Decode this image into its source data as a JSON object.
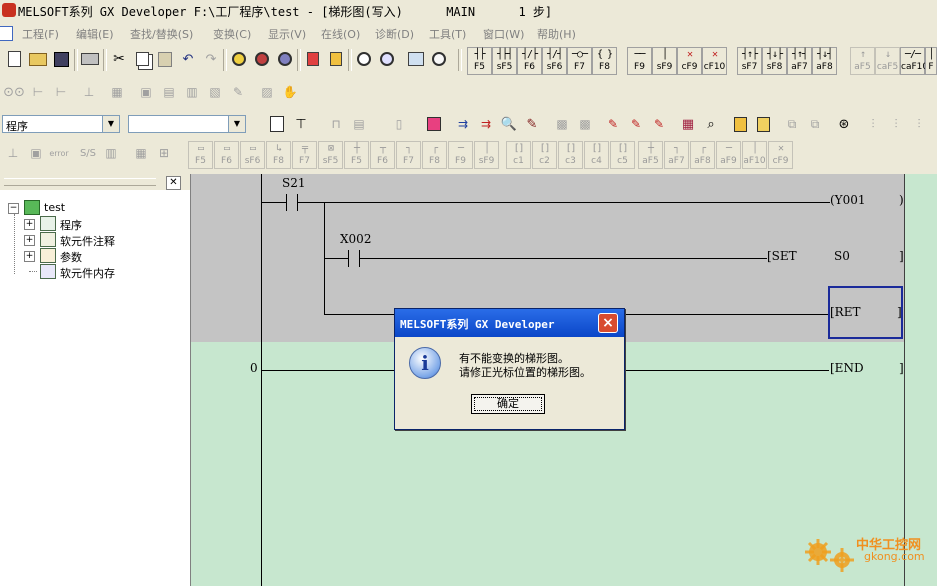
{
  "window": {
    "title": "MELSOFT系列 GX Developer F:\\工厂程序\\test - [梯形图(写入)      MAIN      1 步]"
  },
  "menu": {
    "items": [
      "工程(F)",
      "编辑(E)",
      "查找/替换(S)",
      "变换(C)",
      "显示(V)",
      "在线(O)",
      "诊断(D)",
      "工具(T)",
      "窗口(W)",
      "帮助(H)"
    ]
  },
  "toolbar1": {
    "ladder_keys": [
      "F5",
      "sF5",
      "F6",
      "sF6",
      "F7",
      "F8",
      "F9",
      "sF9",
      "cF9",
      "cF10",
      "sF7",
      "sF8",
      "aF7",
      "aF8",
      "aF5",
      "caF5",
      "caF10",
      "F"
    ]
  },
  "toolbar3": {
    "program_combo": "程序",
    "second_combo": ""
  },
  "toolbar4": {
    "keys": [
      "F5",
      "F6",
      "sF6",
      "F8",
      "F7",
      "sF5",
      "F5",
      "F6",
      "F7",
      "F8",
      "F9",
      "sF9",
      "c1",
      "c2",
      "c3",
      "c4",
      "c5",
      "aF5",
      "aF7",
      "aF8",
      "aF9",
      "aF10",
      "cF9"
    ]
  },
  "project_tree": {
    "root": "test",
    "children": [
      "程序",
      "软元件注释",
      "参数",
      "软元件内存"
    ]
  },
  "ladder": {
    "row1": {
      "contact": "S21",
      "coil": "(Y001",
      "coil_end": ")"
    },
    "row2": {
      "contact": "X002",
      "instr": "[SET",
      "operand": "S0",
      "end": "]"
    },
    "row3": {
      "instr": "[RET",
      "end": "]"
    },
    "row4": {
      "step": "0",
      "instr": "[END",
      "end": "]"
    }
  },
  "dialog": {
    "title": "MELSOFT系列 GX Developer",
    "line1": "有不能变换的梯形图。",
    "line2": "请修正光标位置的梯形图。",
    "ok_label": "确定",
    "close_label": "×",
    "icon_glyph": "i"
  },
  "watermark": {
    "name": "中华工控网",
    "url": "gkong.com"
  }
}
